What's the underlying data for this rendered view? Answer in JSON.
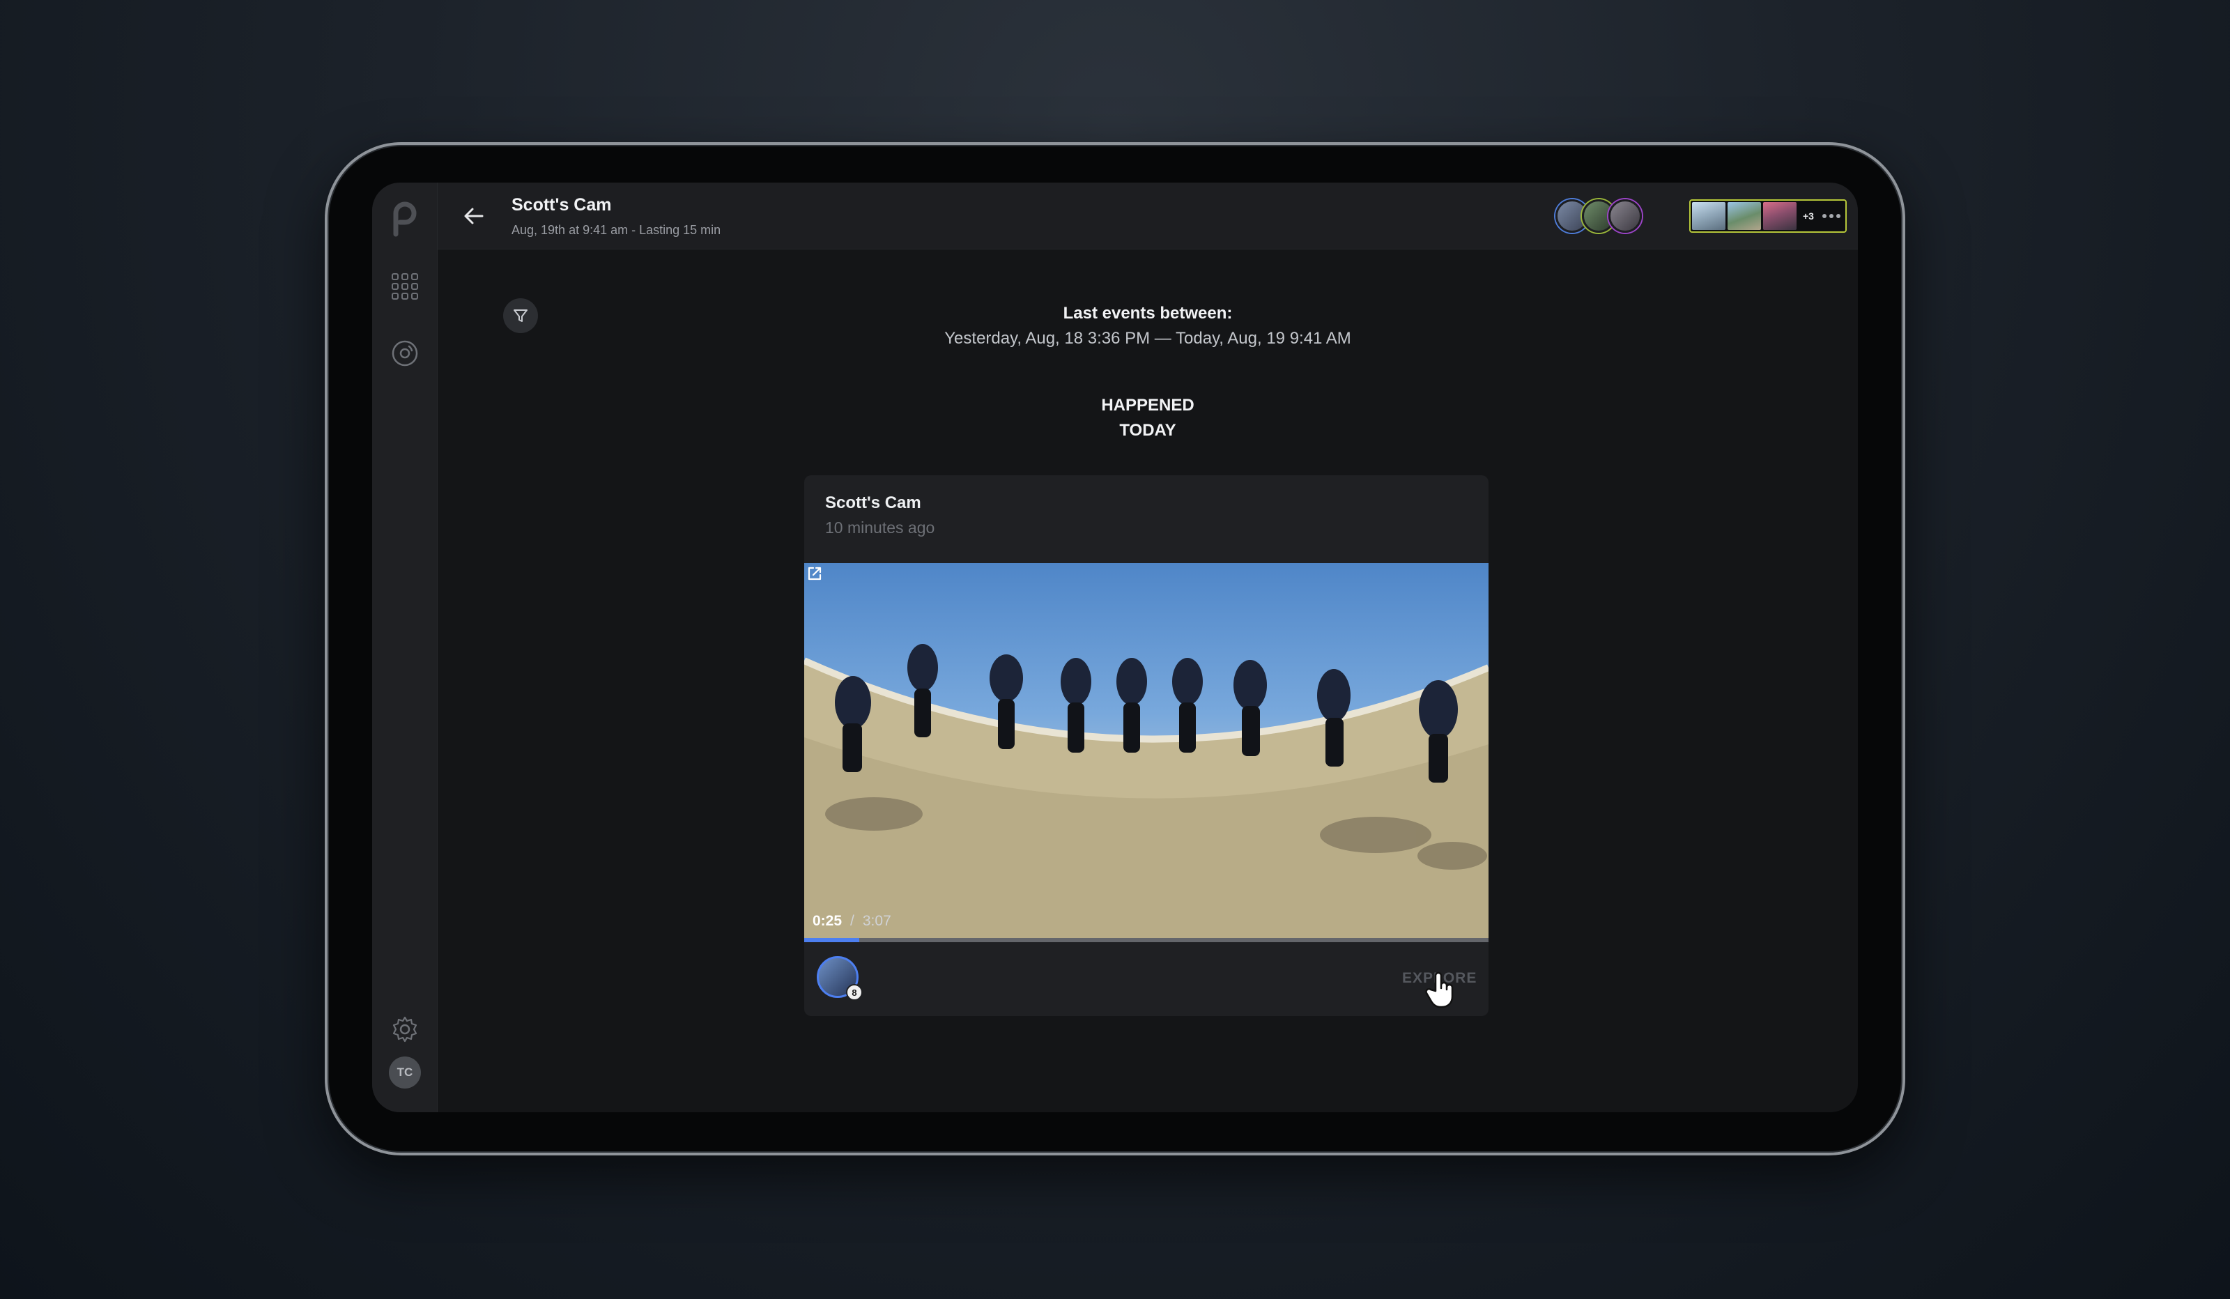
{
  "sidebar": {
    "logo_icon": "p-logo-icon",
    "items": [
      {
        "name": "apps",
        "icon": "grid-icon"
      },
      {
        "name": "live",
        "icon": "radio-icon"
      }
    ],
    "settings_icon": "gear-icon",
    "user_initials": "TC"
  },
  "header": {
    "back_icon": "arrow-left-icon",
    "title": "Scott's Cam",
    "subtitle": "Aug, 19th at 9:41 am - Lasting 15 min",
    "camera_thumbs_more": "+3",
    "more_icon": "ellipsis-icon"
  },
  "filters": {
    "icon": "filter-icon",
    "range_title": "Last events between:",
    "range_value": "Yesterday, Aug, 18 3:36 PM — Today, Aug, 19 9:41 AM"
  },
  "section": {
    "line1": "HAPPENED",
    "line2": "TODAY"
  },
  "event_card": {
    "title": "Scott's Cam",
    "time_ago": "10 minutes ago",
    "video": {
      "current_time": "0:25",
      "separator": "/",
      "duration": "3:07",
      "progress": 0.08,
      "open_icon": "external-link-icon"
    },
    "avatar_badge": "8",
    "explore_label": "EXPLORE"
  },
  "colors": {
    "accent": "#4d7ff0",
    "thumb_border": "#b6c73a",
    "background": "#141517"
  }
}
